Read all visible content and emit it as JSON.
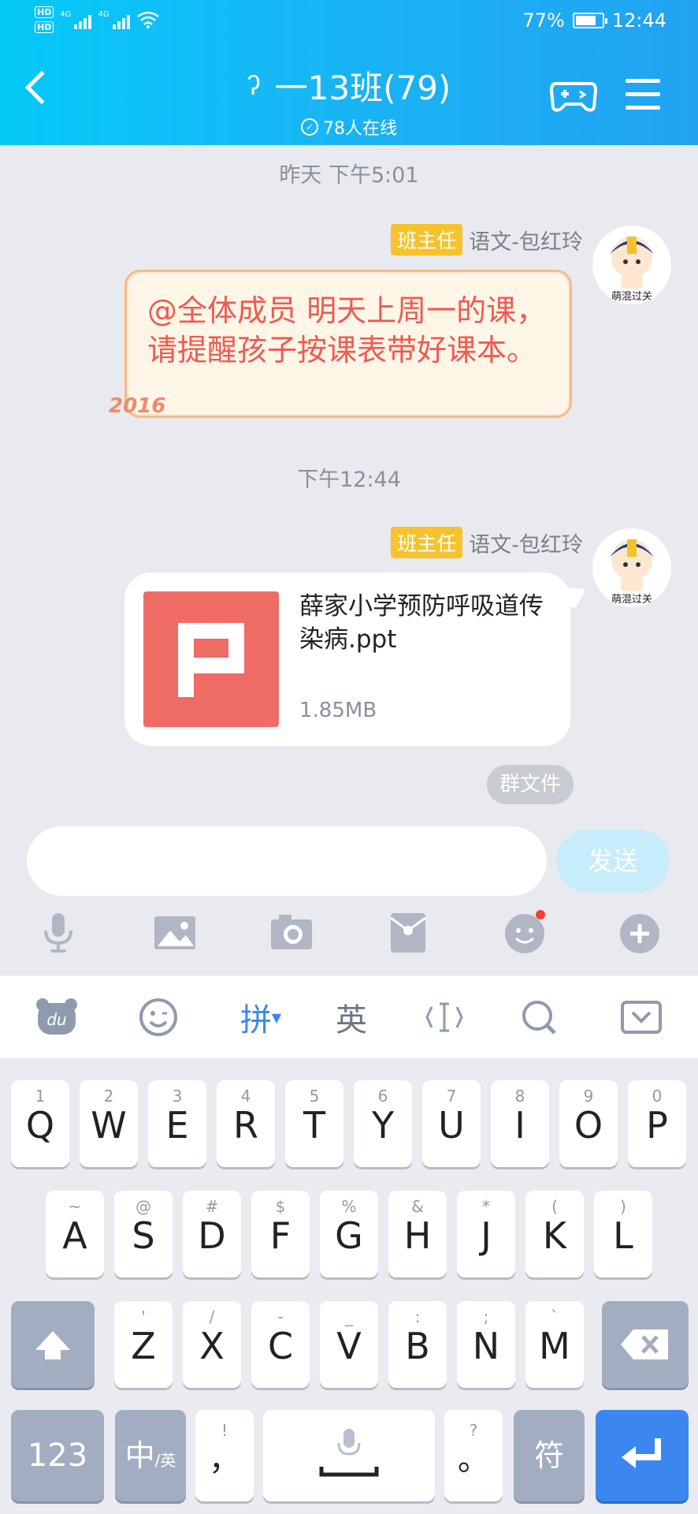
{
  "status_bar": {
    "hd1": "HD",
    "hd2": "HD",
    "net1": "4G",
    "net2": "4G",
    "battery": "77%",
    "time": "12:44"
  },
  "header": {
    "title": "一13班(79)",
    "online": "78人在线"
  },
  "messages": [
    {
      "timestamp": "昨天 下午5:01",
      "role_badge": "班主任",
      "sender": "语文-包红玲",
      "avatar_caption": "萌混过关",
      "text": "@全体成员  明天上周一的课，请提醒孩子按课表带好课本。",
      "decoration": "2016"
    },
    {
      "timestamp": "下午12:44",
      "role_badge": "班主任",
      "sender": "语文-包红玲",
      "avatar_caption": "萌混过关",
      "file_name": "薛家小学预防呼吸道传染病.ppt",
      "file_size": "1.85MB"
    }
  ],
  "group_file_label": "群文件",
  "input": {
    "value": "",
    "send_label": "发送"
  },
  "toolbar": [
    "microphone-icon",
    "image-icon",
    "camera-icon",
    "red-packet-icon",
    "emoji-icon",
    "plus-icon"
  ],
  "keyboard": {
    "top": {
      "logo": "du",
      "pinyin": "拼",
      "english": "英"
    },
    "row1": [
      {
        "k": "Q",
        "h": "1"
      },
      {
        "k": "W",
        "h": "2"
      },
      {
        "k": "E",
        "h": "3"
      },
      {
        "k": "R",
        "h": "4"
      },
      {
        "k": "T",
        "h": "5"
      },
      {
        "k": "Y",
        "h": "6"
      },
      {
        "k": "U",
        "h": "7"
      },
      {
        "k": "I",
        "h": "8"
      },
      {
        "k": "O",
        "h": "9"
      },
      {
        "k": "P",
        "h": "0"
      }
    ],
    "row2": [
      {
        "k": "A",
        "h": "~"
      },
      {
        "k": "S",
        "h": "@"
      },
      {
        "k": "D",
        "h": "#"
      },
      {
        "k": "F",
        "h": "$"
      },
      {
        "k": "G",
        "h": "%"
      },
      {
        "k": "H",
        "h": "&"
      },
      {
        "k": "J",
        "h": "*"
      },
      {
        "k": "K",
        "h": "("
      },
      {
        "k": "L",
        "h": ")"
      }
    ],
    "row3": [
      {
        "k": "Z",
        "h": "'"
      },
      {
        "k": "X",
        "h": "/"
      },
      {
        "k": "C",
        "h": "-"
      },
      {
        "k": "V",
        "h": "_"
      },
      {
        "k": "B",
        "h": ":"
      },
      {
        "k": "N",
        "h": ";"
      },
      {
        "k": "M",
        "h": "`"
      }
    ],
    "num_label": "123",
    "lang_main": "中",
    "lang_sub": "/英",
    "comma": "，",
    "comma_hint": "!",
    "period": "。",
    "period_hint": "?",
    "symbol_label": "符"
  }
}
